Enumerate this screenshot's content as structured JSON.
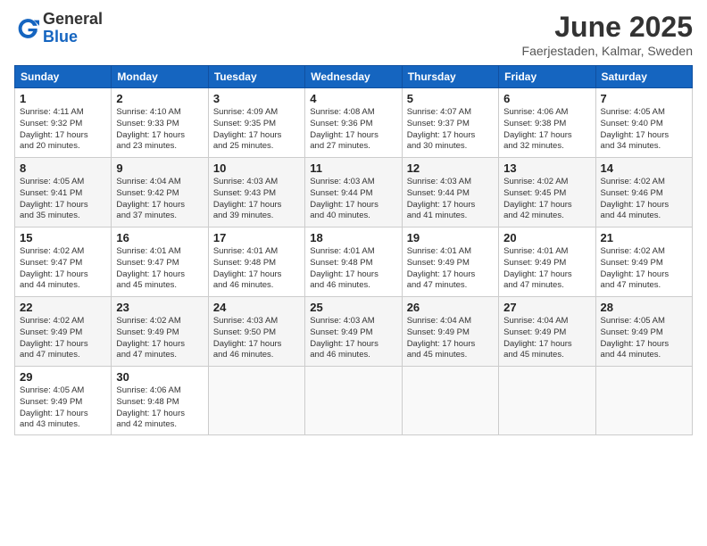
{
  "header": {
    "logo_general": "General",
    "logo_blue": "Blue",
    "title": "June 2025",
    "subtitle": "Faerjestaden, Kalmar, Sweden"
  },
  "weekdays": [
    "Sunday",
    "Monday",
    "Tuesday",
    "Wednesday",
    "Thursday",
    "Friday",
    "Saturday"
  ],
  "weeks": [
    [
      {
        "day": "1",
        "info": "Sunrise: 4:11 AM\nSunset: 9:32 PM\nDaylight: 17 hours\nand 20 minutes."
      },
      {
        "day": "2",
        "info": "Sunrise: 4:10 AM\nSunset: 9:33 PM\nDaylight: 17 hours\nand 23 minutes."
      },
      {
        "day": "3",
        "info": "Sunrise: 4:09 AM\nSunset: 9:35 PM\nDaylight: 17 hours\nand 25 minutes."
      },
      {
        "day": "4",
        "info": "Sunrise: 4:08 AM\nSunset: 9:36 PM\nDaylight: 17 hours\nand 27 minutes."
      },
      {
        "day": "5",
        "info": "Sunrise: 4:07 AM\nSunset: 9:37 PM\nDaylight: 17 hours\nand 30 minutes."
      },
      {
        "day": "6",
        "info": "Sunrise: 4:06 AM\nSunset: 9:38 PM\nDaylight: 17 hours\nand 32 minutes."
      },
      {
        "day": "7",
        "info": "Sunrise: 4:05 AM\nSunset: 9:40 PM\nDaylight: 17 hours\nand 34 minutes."
      }
    ],
    [
      {
        "day": "8",
        "info": "Sunrise: 4:05 AM\nSunset: 9:41 PM\nDaylight: 17 hours\nand 35 minutes."
      },
      {
        "day": "9",
        "info": "Sunrise: 4:04 AM\nSunset: 9:42 PM\nDaylight: 17 hours\nand 37 minutes."
      },
      {
        "day": "10",
        "info": "Sunrise: 4:03 AM\nSunset: 9:43 PM\nDaylight: 17 hours\nand 39 minutes."
      },
      {
        "day": "11",
        "info": "Sunrise: 4:03 AM\nSunset: 9:44 PM\nDaylight: 17 hours\nand 40 minutes."
      },
      {
        "day": "12",
        "info": "Sunrise: 4:03 AM\nSunset: 9:44 PM\nDaylight: 17 hours\nand 41 minutes."
      },
      {
        "day": "13",
        "info": "Sunrise: 4:02 AM\nSunset: 9:45 PM\nDaylight: 17 hours\nand 42 minutes."
      },
      {
        "day": "14",
        "info": "Sunrise: 4:02 AM\nSunset: 9:46 PM\nDaylight: 17 hours\nand 44 minutes."
      }
    ],
    [
      {
        "day": "15",
        "info": "Sunrise: 4:02 AM\nSunset: 9:47 PM\nDaylight: 17 hours\nand 44 minutes."
      },
      {
        "day": "16",
        "info": "Sunrise: 4:01 AM\nSunset: 9:47 PM\nDaylight: 17 hours\nand 45 minutes."
      },
      {
        "day": "17",
        "info": "Sunrise: 4:01 AM\nSunset: 9:48 PM\nDaylight: 17 hours\nand 46 minutes."
      },
      {
        "day": "18",
        "info": "Sunrise: 4:01 AM\nSunset: 9:48 PM\nDaylight: 17 hours\nand 46 minutes."
      },
      {
        "day": "19",
        "info": "Sunrise: 4:01 AM\nSunset: 9:49 PM\nDaylight: 17 hours\nand 47 minutes."
      },
      {
        "day": "20",
        "info": "Sunrise: 4:01 AM\nSunset: 9:49 PM\nDaylight: 17 hours\nand 47 minutes."
      },
      {
        "day": "21",
        "info": "Sunrise: 4:02 AM\nSunset: 9:49 PM\nDaylight: 17 hours\nand 47 minutes."
      }
    ],
    [
      {
        "day": "22",
        "info": "Sunrise: 4:02 AM\nSunset: 9:49 PM\nDaylight: 17 hours\nand 47 minutes."
      },
      {
        "day": "23",
        "info": "Sunrise: 4:02 AM\nSunset: 9:49 PM\nDaylight: 17 hours\nand 47 minutes."
      },
      {
        "day": "24",
        "info": "Sunrise: 4:03 AM\nSunset: 9:50 PM\nDaylight: 17 hours\nand 46 minutes."
      },
      {
        "day": "25",
        "info": "Sunrise: 4:03 AM\nSunset: 9:49 PM\nDaylight: 17 hours\nand 46 minutes."
      },
      {
        "day": "26",
        "info": "Sunrise: 4:04 AM\nSunset: 9:49 PM\nDaylight: 17 hours\nand 45 minutes."
      },
      {
        "day": "27",
        "info": "Sunrise: 4:04 AM\nSunset: 9:49 PM\nDaylight: 17 hours\nand 45 minutes."
      },
      {
        "day": "28",
        "info": "Sunrise: 4:05 AM\nSunset: 9:49 PM\nDaylight: 17 hours\nand 44 minutes."
      }
    ],
    [
      {
        "day": "29",
        "info": "Sunrise: 4:05 AM\nSunset: 9:49 PM\nDaylight: 17 hours\nand 43 minutes."
      },
      {
        "day": "30",
        "info": "Sunrise: 4:06 AM\nSunset: 9:48 PM\nDaylight: 17 hours\nand 42 minutes."
      },
      null,
      null,
      null,
      null,
      null
    ]
  ]
}
